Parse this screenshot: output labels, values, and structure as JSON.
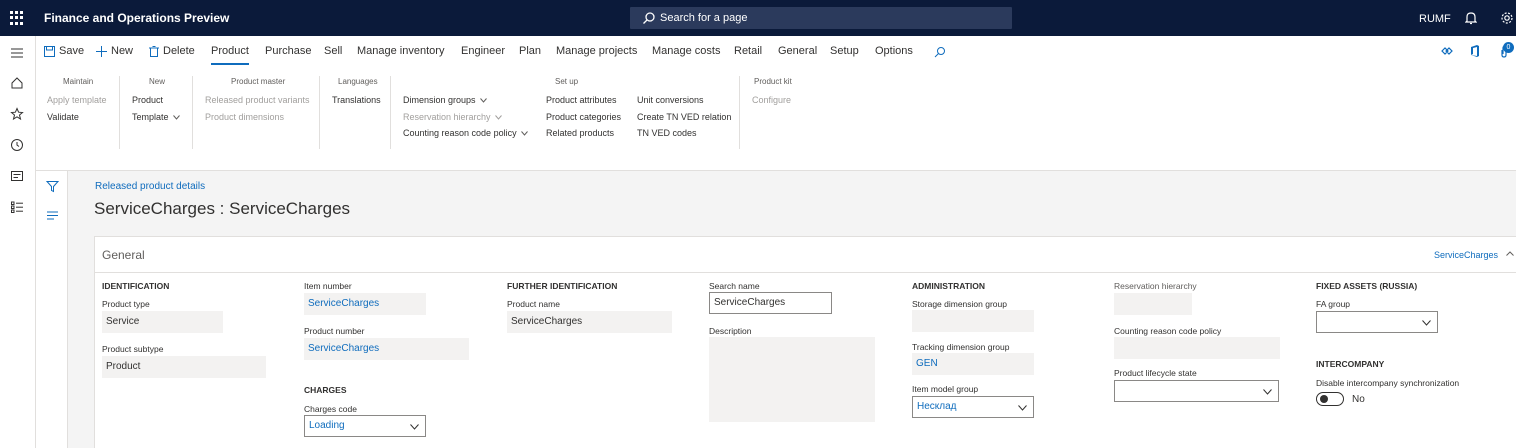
{
  "app": {
    "title": "Finance and Operations Preview",
    "search_placeholder": "Search for a page",
    "company": "RUMF"
  },
  "action_pane": {
    "save": "Save",
    "new": "New",
    "delete": "Delete",
    "tabs": [
      "Product",
      "Purchase",
      "Sell",
      "Manage inventory",
      "Engineer",
      "Plan",
      "Manage projects",
      "Manage costs",
      "Retail",
      "General",
      "Setup",
      "Options"
    ],
    "active_tab": "Product",
    "notification_count": "0",
    "groups": {
      "maintain": {
        "title": "Maintain",
        "items": [
          "Apply template",
          "Validate"
        ]
      },
      "new": {
        "title": "New",
        "items": [
          "Product",
          "Template"
        ]
      },
      "product_master": {
        "title": "Product master",
        "items": [
          "Released product variants",
          "Product dimensions"
        ]
      },
      "languages": {
        "title": "Languages",
        "items": [
          "Translations"
        ]
      },
      "setup": {
        "title": "Set up",
        "items": [
          "Dimension groups",
          "Reservation hierarchy",
          "Counting reason code policy",
          "Product attributes",
          "Product categories",
          "Related products",
          "Unit conversions",
          "Create TN VED relation",
          "TN VED codes"
        ]
      },
      "product_kit": {
        "title": "Product kit",
        "items": [
          "Configure"
        ]
      }
    }
  },
  "page": {
    "breadcrumb": "Released product details",
    "title": "ServiceCharges : ServiceCharges"
  },
  "general": {
    "title": "General",
    "summary": "ServiceCharges",
    "identification": {
      "header": "IDENTIFICATION",
      "product_type_label": "Product type",
      "product_type": "Service",
      "product_subtype_label": "Product subtype",
      "product_subtype": "Product"
    },
    "item": {
      "item_number_label": "Item number",
      "item_number": "ServiceCharges",
      "product_number_label": "Product number",
      "product_number": "ServiceCharges"
    },
    "charges": {
      "header": "CHARGES",
      "charges_code_label": "Charges code",
      "charges_code": "Loading"
    },
    "further_identification": {
      "header": "FURTHER IDENTIFICATION",
      "product_name_label": "Product name",
      "product_name": "ServiceCharges"
    },
    "search": {
      "search_name_label": "Search name",
      "search_name": "ServiceCharges",
      "description_label": "Description"
    },
    "administration": {
      "header": "ADMINISTRATION",
      "storage_dim_label": "Storage dimension group",
      "storage_dim": "",
      "tracking_dim_label": "Tracking dimension group",
      "tracking_dim": "GEN",
      "item_model_label": "Item model group",
      "item_model": "Несклад"
    },
    "reservation": {
      "reservation_label": "Reservation hierarchy",
      "counting_label": "Counting reason code policy",
      "lifecycle_label": "Product lifecycle state"
    },
    "fixed_assets": {
      "header": "FIXED ASSETS (RUSSIA)",
      "fa_group_label": "FA group",
      "fa_group": ""
    },
    "intercompany": {
      "header": "INTERCOMPANY",
      "disable_sync_label": "Disable intercompany synchronization",
      "disable_sync_value": "No"
    }
  }
}
